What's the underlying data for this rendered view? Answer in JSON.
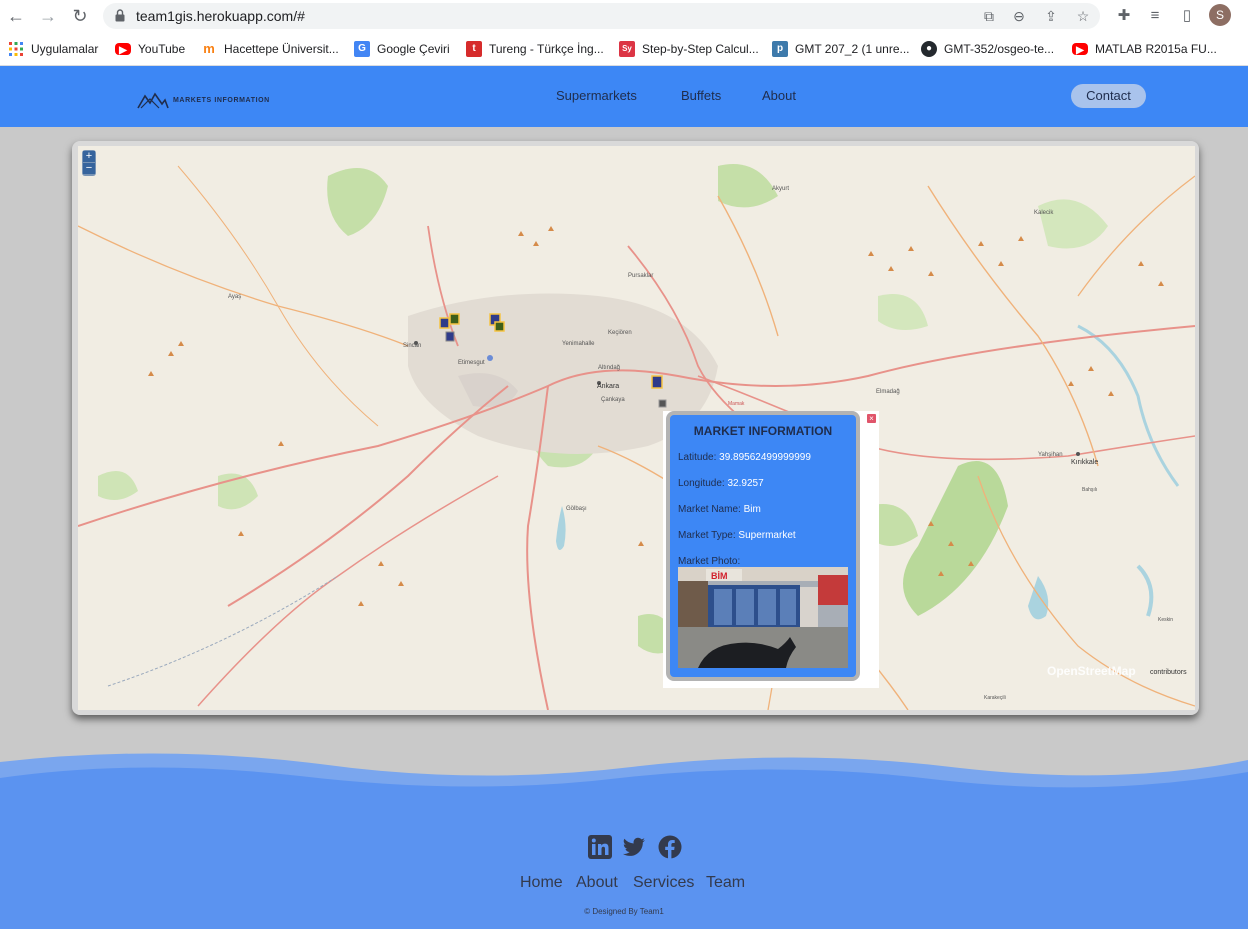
{
  "browser": {
    "url": "team1gis.herokuapp.com/#",
    "profile_initial": "S",
    "bookmarks": [
      {
        "label": "Uygulamalar",
        "icon": "apps-grid-icon"
      },
      {
        "label": "YouTube",
        "icon": "youtube-icon"
      },
      {
        "label": "Hacettepe Üniversit...",
        "icon": "moodle-icon"
      },
      {
        "label": "Google Çeviri",
        "icon": "google-translate-icon"
      },
      {
        "label": "Tureng - Türkçe İng...",
        "icon": "tureng-icon"
      },
      {
        "label": "Step-by-Step Calcul...",
        "icon": "symbolab-icon"
      },
      {
        "label": "GMT 207_2 (1 unre...",
        "icon": "piazza-icon"
      },
      {
        "label": "GMT-352/osgeo-te...",
        "icon": "github-icon"
      },
      {
        "label": "MATLAB R2015a FU...",
        "icon": "youtube-icon"
      }
    ]
  },
  "header": {
    "logo_text": "MARKETS INFORMATION",
    "nav": [
      "Supermarkets",
      "Buffets",
      "About"
    ],
    "contact": "Contact"
  },
  "map": {
    "zoom_in": "+",
    "zoom_out": "−",
    "attribution": "OpenStreetMap",
    "attribution_suffix": "contributors",
    "popup": {
      "title": "MARKET INFORMATION",
      "latitude_label": "Latitude:",
      "latitude": "39.89562499999999",
      "longitude_label": "Longitude:",
      "longitude": "32.9257",
      "name_label": "Market Name:",
      "name": "Bim",
      "type_label": "Market Type:",
      "type": "Supermarket",
      "photo_label": "Market Photo:",
      "photo_sign": "BİM",
      "close": "×"
    },
    "place_labels": [
      "Ankara",
      "Çankaya",
      "Yenimahalle",
      "Keçiören",
      "Altındağ",
      "Etimesgut",
      "Sincan",
      "Pursaklar",
      "Gölbaşı",
      "Elmadağ",
      "Kırıkkale",
      "Yahşihan",
      "Ayaş",
      "Akyurt",
      "Kalecik",
      "Mamak",
      "Bahşılı",
      "Keskin",
      "Karakeçili"
    ]
  },
  "footer": {
    "social": [
      "linkedin-icon",
      "twitter-icon",
      "facebook-icon"
    ],
    "links": [
      "Home",
      "About",
      "Services",
      "Team"
    ],
    "credit": "© Designed By Team1"
  }
}
